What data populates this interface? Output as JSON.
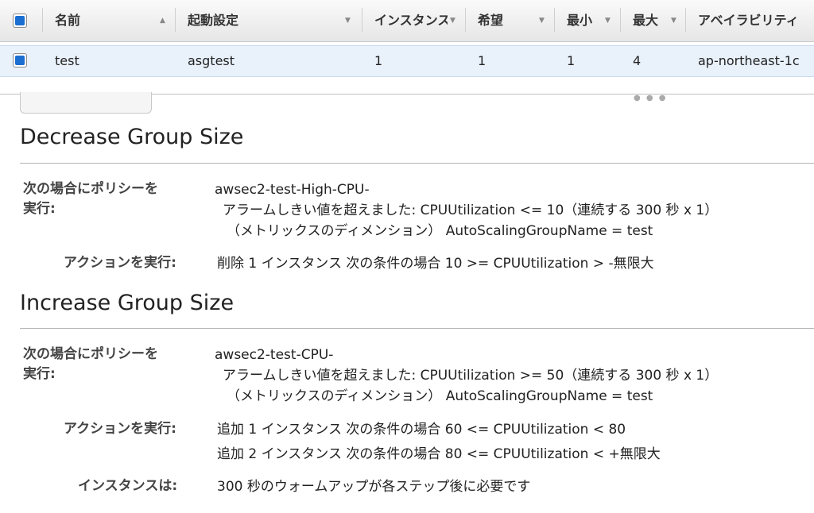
{
  "table": {
    "headers": [
      "名前",
      "起動設定",
      "インスタンス",
      "希望",
      "最小",
      "最大",
      "アベイラビリティ"
    ],
    "row": [
      "test",
      "asgtest",
      "1",
      "1",
      "1",
      "4",
      "ap-northeast-1c"
    ]
  },
  "decrease": {
    "title": "Decrease Group Size",
    "cond_label_1": "次の場合にポリシーを",
    "cond_label_2": "実行:",
    "alarm_name": "awsec2-test-High-CPU-",
    "alarm_text": "アラームしきい値を超えました: CPUUtilization <= 10（連続する 300 秒 x 1）",
    "dimension_text": "（メトリックスのディメンション） AutoScalingGroupName = test",
    "action_label": "アクションを実行:",
    "action_1": "削除 1 インスタンス 次の条件の場合 10 >= CPUUtilization > -無限大"
  },
  "increase": {
    "title": "Increase Group Size",
    "cond_label_1": "次の場合にポリシーを",
    "cond_label_2": "実行:",
    "alarm_name": "awsec2-test-CPU-",
    "alarm_text": "アラームしきい値を超えました: CPUUtilization >= 50（連続する 300 秒 x 1）",
    "dimension_text": "（メトリックスのディメンション） AutoScalingGroupName = test",
    "action_label": "アクションを実行:",
    "action_1": "追加 1 インスタンス 次の条件の場合 60 <= CPUUtilization < 80",
    "action_2": "追加 2 インスタンス 次の条件の場合 80 <= CPUUtilization < +無限大",
    "instances_label": "インスタンスは:",
    "instances_text": "300 秒のウォームアップが各ステップ後に必要です"
  }
}
